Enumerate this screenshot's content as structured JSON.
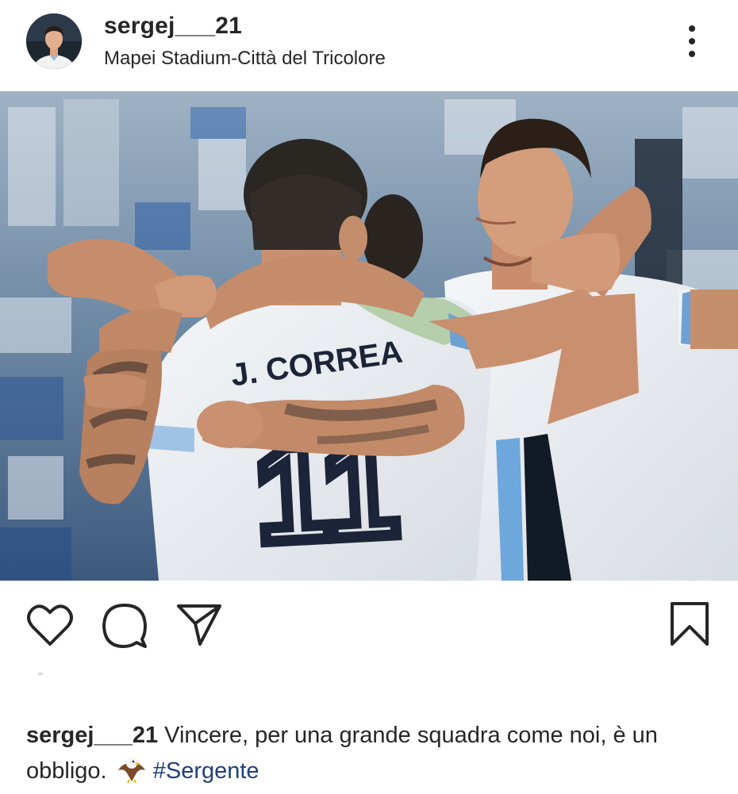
{
  "post": {
    "username": "sergej___21",
    "location": "Mapei Stadium-Città del Tricolore",
    "menu_icon": "more-vertical-icon",
    "image": {
      "jersey_name": "J. CORREA",
      "jersey_number": "11"
    },
    "actions": {
      "like_icon": "heart-icon",
      "comment_icon": "comment-icon",
      "share_icon": "send-icon",
      "save_icon": "bookmark-icon"
    },
    "caption": {
      "username": "sergej___21",
      "text": "Vincere, per una grande squadra come noi, è un obbligo.",
      "emoji": "eagle-emoji",
      "hashtag": "#Sergente"
    }
  }
}
